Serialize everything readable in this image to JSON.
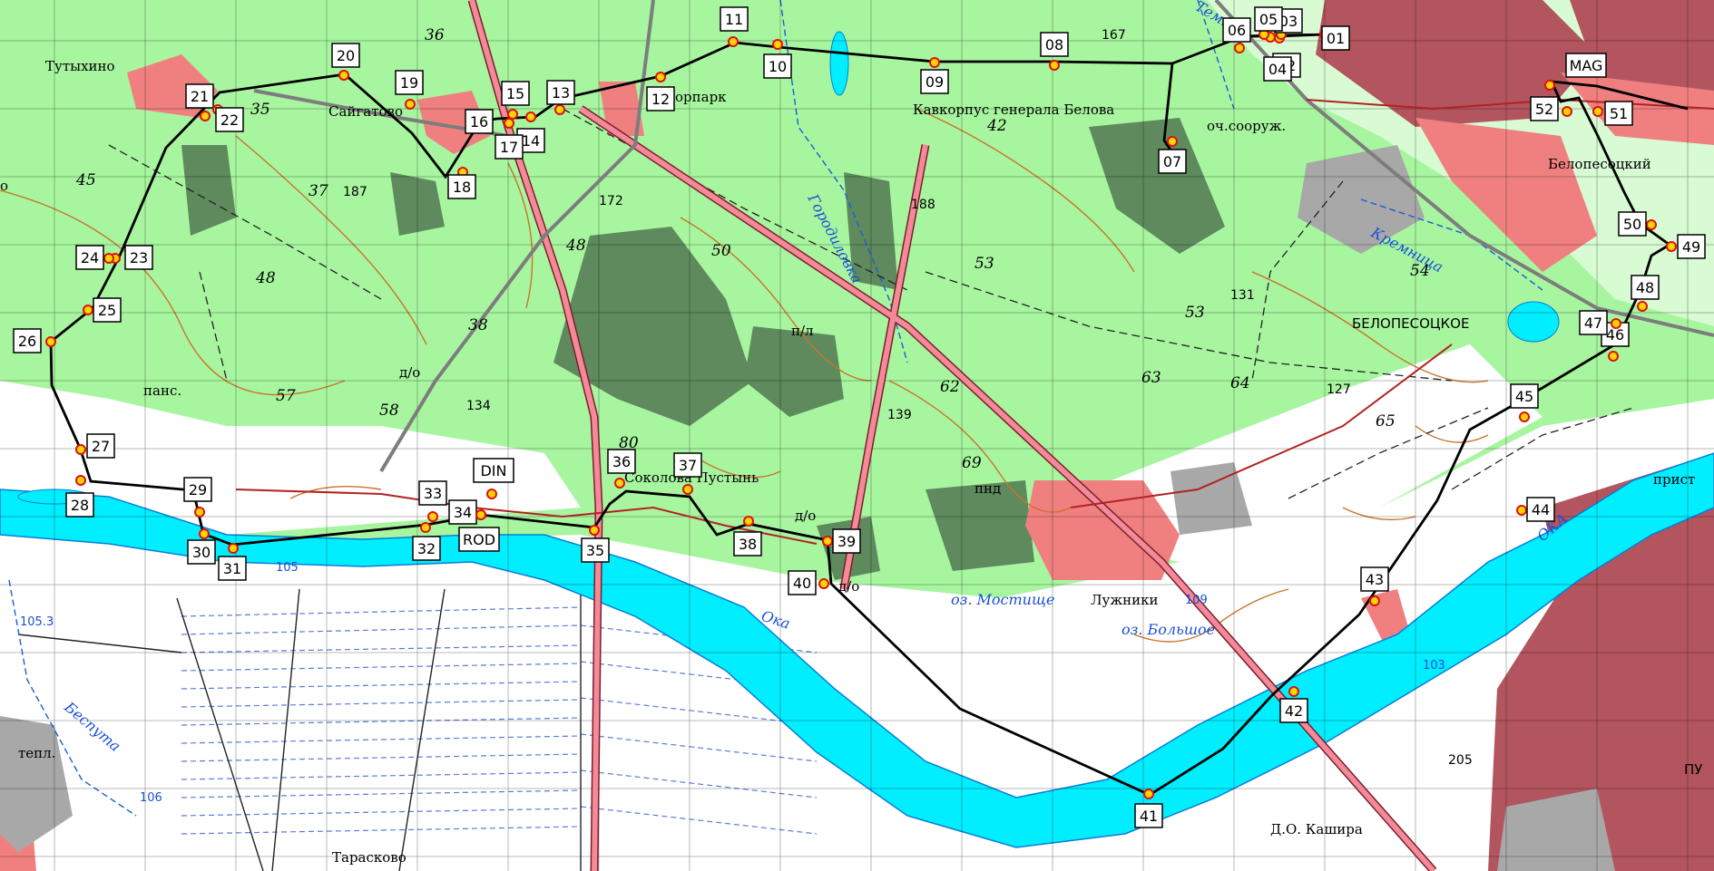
{
  "map": {
    "places": {
      "tutykhino": "Тутыхино",
      "saigatovo": "Сайгатово",
      "park": "орпарк",
      "kavkorpus": "Кавкорпус генерала Белова",
      "och": "оч.сооруж.",
      "belopesotskiy": "Белопесоцкий",
      "belopesotskoe": "БЕЛОПЕСОЦКОЕ",
      "sokolova": "Соколова Пустынь",
      "luzhniki": "Лужники",
      "mostishche": "оз. Мостище",
      "bolshoe": "оз. Большое",
      "kashira": "Д.О. Кашира",
      "tarasko": "Тарасково",
      "pris": "прист",
      "teplo": "тепл.",
      "pans": "панс.",
      "pl": "п/л",
      "do1": "д/о",
      "do2": "д/о",
      "do3": "д/о",
      "pnd": "пнд",
      "pu": "ПУ",
      "o": "о"
    },
    "water": {
      "oka1": "Ока",
      "oka2": "ОКА",
      "kremnitsa": "Кремница",
      "gorodilovka": "Городиловка",
      "besputa": "Беспута",
      "temn": "Темн"
    },
    "elevations": {
      "e187": "187",
      "e172": "172",
      "e188": "188",
      "e131": "131",
      "e127": "127",
      "e134": "134",
      "e139": "139",
      "e167": "167",
      "e105": "105",
      "e1053": "105.3",
      "e106": "106",
      "e109": "109",
      "e103": "103",
      "e205": "205"
    },
    "grid_numbers": {
      "g36": "36",
      "g35": "35",
      "g37": "37",
      "g45": "45",
      "g48a": "48",
      "g48b": "48",
      "g50": "50",
      "g42": "42",
      "g53a": "53",
      "g53b": "53",
      "g54": "54",
      "g57": "57",
      "g58": "58",
      "g38": "38",
      "g80": "80",
      "g62": "62",
      "g63": "63",
      "g64": "64",
      "g65": "65",
      "g69": "69"
    },
    "checkpoints": [
      "01",
      "02",
      "03",
      "04",
      "05",
      "06",
      "07",
      "08",
      "09",
      "10",
      "11",
      "12",
      "13",
      "14",
      "15",
      "16",
      "17",
      "18",
      "19",
      "20",
      "21",
      "22",
      "23",
      "24",
      "25",
      "26",
      "27",
      "28",
      "29",
      "30",
      "31",
      "32",
      "33",
      "34",
      "35",
      "36",
      "37",
      "38",
      "39",
      "40",
      "41",
      "42",
      "43",
      "44",
      "45",
      "46",
      "47",
      "48",
      "49",
      "50",
      "51",
      "52",
      "MAG",
      "DIN",
      "ROD"
    ]
  }
}
